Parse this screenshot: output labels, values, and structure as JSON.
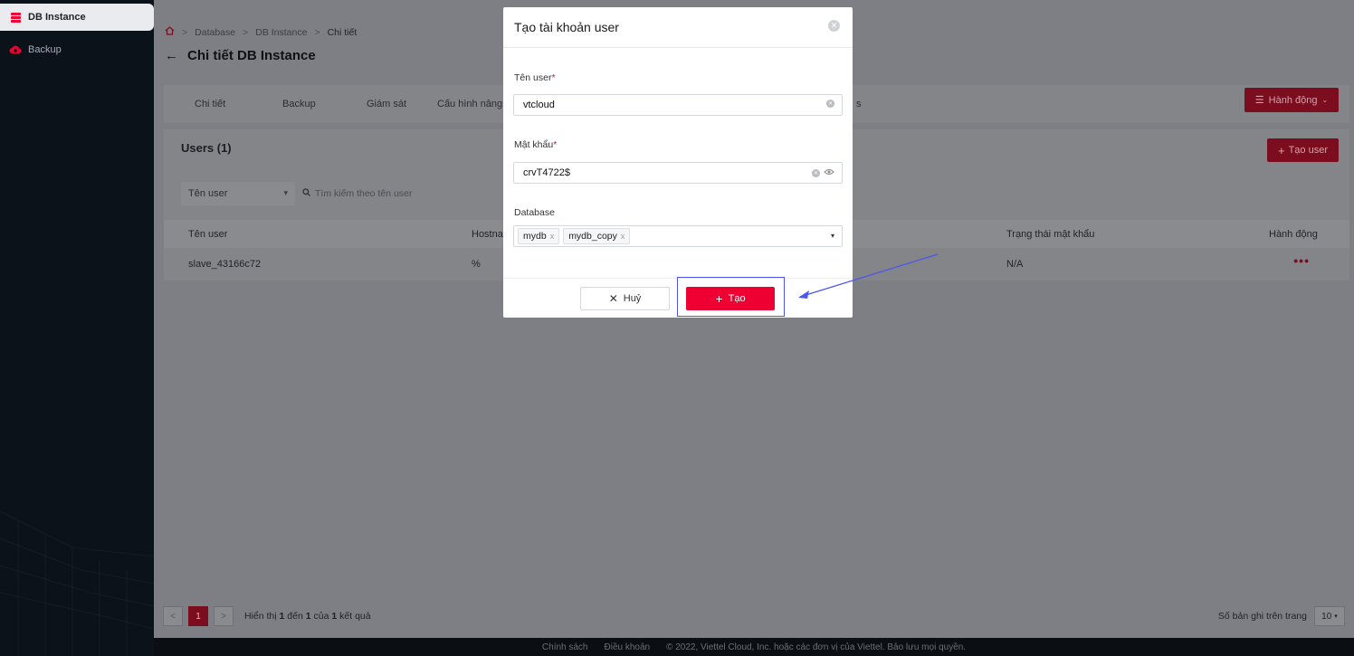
{
  "sidebar": {
    "items": [
      {
        "label": "DB Instance",
        "icon": "database-icon"
      },
      {
        "label": "Backup",
        "icon": "cloud-backup-icon"
      }
    ]
  },
  "breadcrumb": [
    "Database",
    "DB Instance",
    "Chi tiết"
  ],
  "page_title": "Chi tiết DB Instance",
  "tabs": [
    "Chi tiết",
    "Backup",
    "Giám sát",
    "Cấu hình nâng c"
  ],
  "tab_overflow_text": "s",
  "action_button": "Hành động",
  "users": {
    "title": "Users (1)",
    "add_button": "Tạo user",
    "filter_select": "Tên user",
    "search_placeholder": "Tìm kiếm theo tên user",
    "columns": [
      "Tên user",
      "Hostna",
      "Trạng thái mật khẩu",
      "Hành động"
    ],
    "rows": [
      {
        "name": "slave_43166c72",
        "host": "%",
        "password_status": "N/A",
        "actions": "•••"
      }
    ]
  },
  "pagination": {
    "current_page": "1",
    "info_prefix": "Hiển thị",
    "from": "1",
    "info_to": "đến",
    "to": "1",
    "info_of": "của",
    "total": "1",
    "info_suffix": "kết quả",
    "page_size_label": "Số bản ghi trên trang",
    "page_size": "10"
  },
  "footer": {
    "policy": "Chính sách",
    "terms": "Điều khoản",
    "copyright": "© 2022, Viettel Cloud, Inc. hoặc các đơn vị của Viettel. Bảo lưu mọi quyền."
  },
  "modal": {
    "title": "Tạo tài khoản user",
    "username_label": "Tên user",
    "username_value": "vtcloud",
    "password_label": "Mật khẩu",
    "password_value": "crvT4722$",
    "database_label": "Database",
    "database_tags": [
      "mydb",
      "mydb_copy"
    ],
    "cancel_label": "Huỷ",
    "create_label": "Tạo"
  },
  "colors": {
    "brand_red": "#ee0033",
    "dim_red": "#7b0d1f",
    "highlight": "#4c55f0"
  }
}
